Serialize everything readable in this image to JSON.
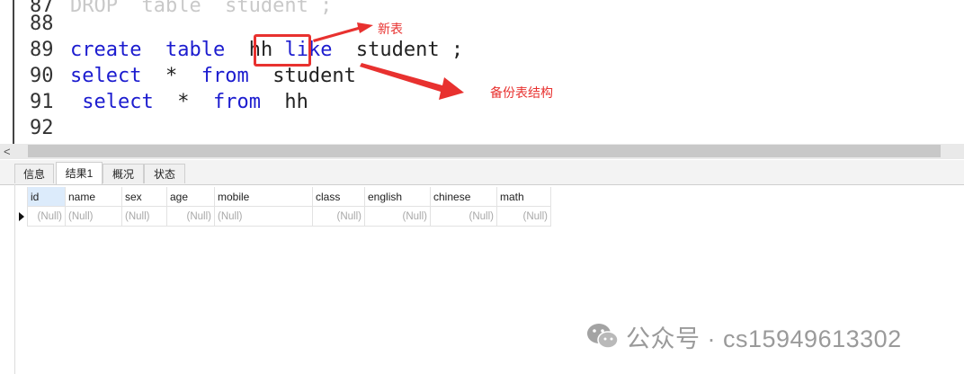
{
  "editor": {
    "lines": [
      {
        "num": "87",
        "tokens": [
          {
            "t": "DROP  table  student ;",
            "c": "faded"
          }
        ]
      },
      {
        "num": "88",
        "tokens": []
      },
      {
        "num": "89",
        "tokens": [
          {
            "t": "create",
            "c": "kw"
          },
          {
            "t": "  ",
            "c": "id"
          },
          {
            "t": "table",
            "c": "kw"
          },
          {
            "t": "  hh ",
            "c": "id"
          },
          {
            "t": "like",
            "c": "kw"
          },
          {
            "t": "  student ;",
            "c": "id"
          }
        ]
      },
      {
        "num": "90",
        "tokens": [
          {
            "t": "select",
            "c": "kw"
          },
          {
            "t": "  *  ",
            "c": "id"
          },
          {
            "t": "from",
            "c": "kw"
          },
          {
            "t": "  student",
            "c": "id"
          }
        ]
      },
      {
        "num": "91",
        "tokens": [
          {
            "t": " select",
            "c": "kw"
          },
          {
            "t": "  *  ",
            "c": "id"
          },
          {
            "t": "from",
            "c": "kw"
          },
          {
            "t": "  hh",
            "c": "id"
          }
        ]
      },
      {
        "num": "92",
        "tokens": []
      }
    ]
  },
  "annotations": {
    "new_table": "新表",
    "backup_structure": "备份表结构",
    "color": "#e8312f"
  },
  "scrollbar": {
    "left_arrow": "<"
  },
  "tabs": [
    {
      "label": "信息",
      "active": false
    },
    {
      "label": "结果1",
      "active": true
    },
    {
      "label": "概况",
      "active": false
    },
    {
      "label": "状态",
      "active": false
    }
  ],
  "grid": {
    "columns": [
      "id",
      "name",
      "sex",
      "age",
      "mobile",
      "class",
      "english",
      "chinese",
      "math"
    ],
    "rows": [
      [
        "(Null)",
        "(Null)",
        "(Null)",
        "(Null)",
        "(Null)",
        "(Null)",
        "(Null)",
        "(Null)",
        "(Null)"
      ]
    ]
  },
  "watermark": {
    "icon": "wechat-icon",
    "text": "公众号 · cs15949613302"
  }
}
